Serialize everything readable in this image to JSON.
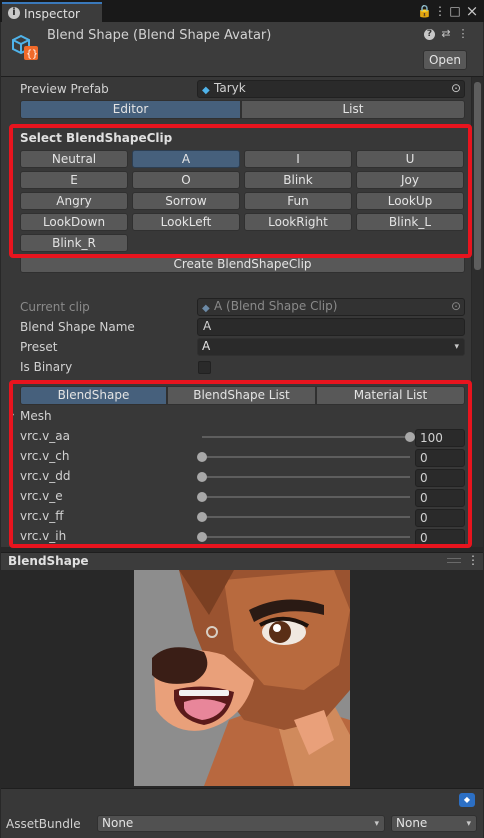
{
  "window": {
    "tab_label": "Inspector",
    "tab_info_glyph": "i",
    "lock_glyph": "🔒",
    "menu_glyph": "⋮",
    "maximize_glyph": "□",
    "close_glyph": "×"
  },
  "header": {
    "title": "Blend Shape (Blend Shape Avatar)",
    "open_label": "Open",
    "help_glyph": "?",
    "settings_glyph": "⇄",
    "more_glyph": "⋮"
  },
  "preview_prefab": {
    "label": "Preview Prefab",
    "value": "Taryk",
    "picker_glyph": "⊙"
  },
  "mode_tabs": [
    "Editor",
    "List"
  ],
  "mode_selected_index": 0,
  "select_clip": {
    "title": "Select BlendShapeClip",
    "buttons": [
      "Neutral",
      "A",
      "I",
      "U",
      "E",
      "O",
      "Blink",
      "Joy",
      "Angry",
      "Sorrow",
      "Fun",
      "LookUp",
      "LookDown",
      "LookLeft",
      "LookRight",
      "Blink_L",
      "Blink_R"
    ],
    "selected": "A",
    "create_label": "Create BlendShapeClip"
  },
  "current_clip": {
    "label": "Current clip",
    "value": "A (Blend Shape Clip)",
    "picker_glyph": "⊙"
  },
  "blend_shape_name": {
    "label": "Blend Shape Name",
    "value": "A"
  },
  "preset": {
    "label": "Preset",
    "value": "A",
    "arrow_glyph": "▾"
  },
  "is_binary": {
    "label": "Is Binary",
    "checked": false
  },
  "sub_tabs": [
    "BlendShape",
    "BlendShape List",
    "Material List"
  ],
  "sub_tab_selected_index": 0,
  "mesh": {
    "label": "Mesh",
    "rows": [
      {
        "name": "vrc.v_aa",
        "value": "100",
        "level": 1.0
      },
      {
        "name": "vrc.v_ch",
        "value": "0",
        "level": 0.0
      },
      {
        "name": "vrc.v_dd",
        "value": "0",
        "level": 0.0
      },
      {
        "name": "vrc.v_e",
        "value": "0",
        "level": 0.0
      },
      {
        "name": "vrc.v_ff",
        "value": "0",
        "level": 0.0
      },
      {
        "name": "vrc.v_ih",
        "value": "0",
        "level": 0.0
      }
    ]
  },
  "preview": {
    "title": "BlendShape",
    "menu_glyph": "⋮"
  },
  "footer": {
    "asset_bundle_label": "AssetBundle",
    "bundle_value": "None",
    "variant_value": "None",
    "tag_glyph": "◆"
  },
  "colors": {
    "highlight_red": "#e8141e",
    "selected_blue": "#46607c",
    "tab_accent": "#3a79bb"
  }
}
